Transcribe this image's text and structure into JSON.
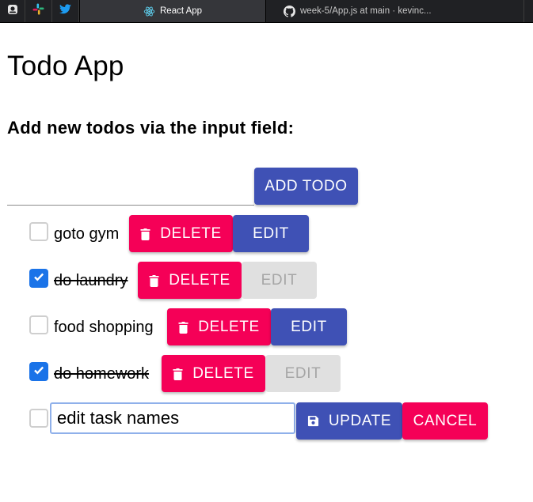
{
  "browser": {
    "tabs": [
      {
        "title": "React App",
        "active": true,
        "icon": "react-icon"
      },
      {
        "title": "week-5/App.js at main · kevinc...",
        "active": false,
        "icon": "github-icon"
      }
    ],
    "pinned_icons": [
      "app-icon",
      "slack-icon",
      "twitter-icon"
    ]
  },
  "page": {
    "title": "Todo App",
    "subtitle": "Add new todos via the input field:"
  },
  "new_todo": {
    "value": "",
    "add_label": "ADD TODO"
  },
  "todos": [
    {
      "text": "goto gym",
      "completed": false,
      "delete_label": "DELETE",
      "edit_label": "EDIT"
    },
    {
      "text": "do laundry",
      "completed": true,
      "delete_label": "DELETE",
      "edit_label": "EDIT"
    },
    {
      "text": "food shopping",
      "completed": false,
      "delete_label": "DELETE",
      "edit_label": "EDIT"
    },
    {
      "text": "do homework",
      "completed": true,
      "delete_label": "DELETE",
      "edit_label": "EDIT"
    }
  ],
  "editing": {
    "completed": false,
    "value": "edit task names",
    "update_label": "UPDATE",
    "cancel_label": "CANCEL"
  },
  "colors": {
    "primary": "#3f51b5",
    "secondary": "#f50057",
    "disabled": "#e0e0e0",
    "checkbox_checked": "#1a73e8"
  }
}
